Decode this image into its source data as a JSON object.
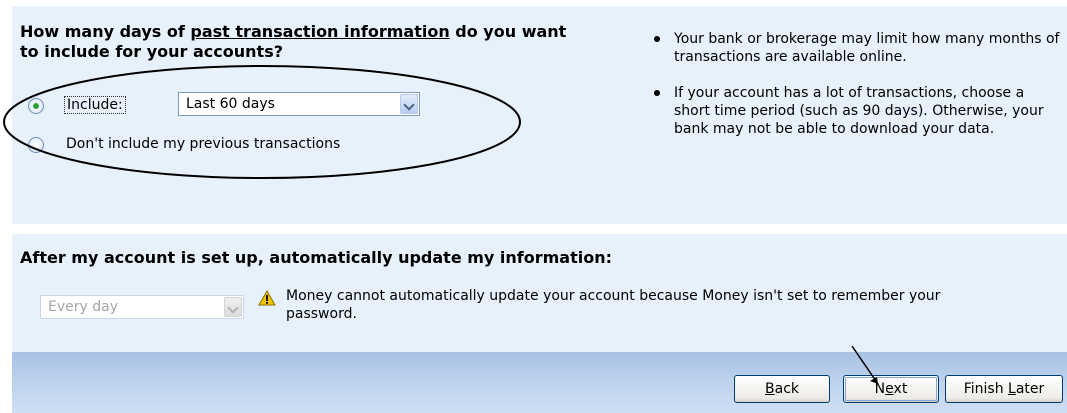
{
  "history": {
    "heading_part1": "How many days of ",
    "heading_underlined": "past transaction information",
    "heading_part2": " do you want to include for your accounts?",
    "include_option": {
      "label": "Include:",
      "selected": true
    },
    "period_select": {
      "value": "Last 60 days"
    },
    "exclude_option": {
      "label": "Don't include my previous transactions",
      "selected": false
    }
  },
  "tips": [
    "Your bank or brokerage may limit how many months of transactions are available online.",
    "If your account has a lot of transactions, choose a short time period (such as 90 days). Otherwise, your bank may not be able to download your data."
  ],
  "update": {
    "heading": "After my account is set up, automatically update my information:",
    "frequency_select": {
      "value": "Every day",
      "disabled": true
    },
    "warning_icon": "warning-icon",
    "warning_text": "Money cannot automatically update your account because Money isn't set to remember your password."
  },
  "buttons": {
    "back": {
      "label": "Back",
      "mnemonic": "B"
    },
    "next": {
      "label": "Next",
      "mnemonic": "e"
    },
    "finish_later": {
      "label": "Finish Later",
      "mnemonic": "L"
    }
  },
  "colors": {
    "panel": "#e7f1fb",
    "footer": "#b7cdea",
    "radio_check": "#2f9f3b",
    "warning": "#f5c400"
  }
}
